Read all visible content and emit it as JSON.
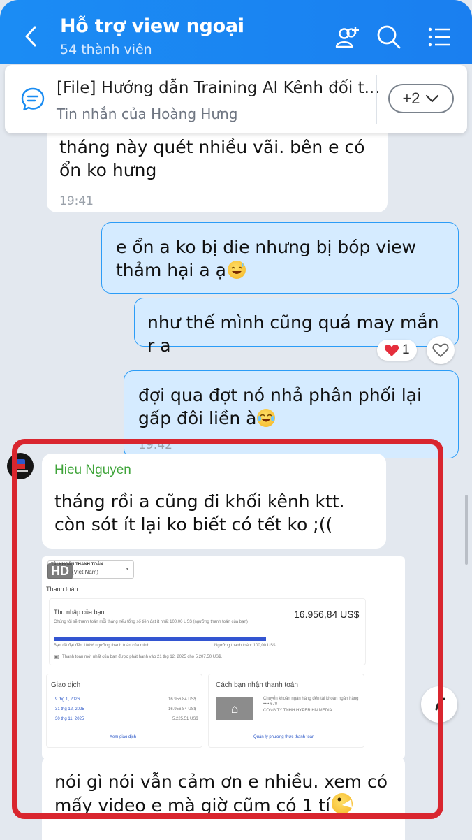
{
  "header": {
    "title": "Hỗ trợ view ngoại",
    "subtitle": "54 thành viên"
  },
  "pinned": {
    "title": "[File] Hướng dẫn Training AI Kênh đối t...",
    "subtitle": "Tin nhắn của Hoàng Hưng",
    "more_label": "+2"
  },
  "messages": [
    {
      "text": "tháng này quét nhiều vãi. bên e có ổn ko hưng",
      "time": "19:41"
    },
    {
      "text": "e ổn a ko bị die nhưng bị bóp view thảm hại a ạ"
    },
    {
      "text": "như thế mình cũng quá may mắn r a",
      "reaction_count": "1"
    },
    {
      "text": "đợi qua đợt nó nhả phân phối lại gấp đôi liền à",
      "time": "19:42"
    },
    {
      "sender": "Hieu Nguyen",
      "text": "tháng rồi a cũng đi khối kênh ktt. còn sót ít lại ko biết có tết ko ;(("
    },
    {
      "text": "nói gì nói vẫn cảm ơn e nhiều. xem có mấy video e mà giờ cũm có 1 tí"
    }
  ],
  "image": {
    "badge": "HD",
    "dropdown_title": "TÀI KHOẢN THANH TOÁN",
    "dropdown_value": "(Việt Nam)",
    "heading": "Thanh toán",
    "income_title": "Thu nhập của bạn",
    "income_amount": "16.956,84 US$",
    "income_note": "Chúng tôi sẽ thanh toán mỗi tháng nếu tổng số tiền đạt ít nhất 100,00 US$ (ngưỡng thanh toán của bạn)",
    "progress_left": "Bạn đã đạt đến 100% ngưỡng thanh toán của mình",
    "progress_right": "Ngưỡng thanh toán: 100,00 US$",
    "progress": 1.0,
    "last_payment": "Thanh toán mới nhất của bạn được phát hành vào 21 thg 12, 2025 cho 5.207,50 US$.",
    "transactions_title": "Giao dịch",
    "transactions": [
      {
        "date": "9 thg 1, 2026",
        "amount": "16.956,84 US$"
      },
      {
        "date": "31 thg 12, 2025",
        "amount": "16.956,84 US$"
      },
      {
        "date": "30 thg 11, 2025",
        "amount": "5.225,51 US$"
      }
    ],
    "transactions_link": "Xem giao dịch",
    "payout_title": "Cách bạn nhận thanh toán",
    "payout_line1": "Chuyển khoản ngân hàng đến tài khoản ngân hàng",
    "payout_line2": "•••• 670",
    "payout_line3": "CONG TY TNHH HYPER HN MEDIA",
    "payout_link": "Quản lý phương thức thanh toán"
  },
  "colors": {
    "accent": "#1b8cf4",
    "outgoing": "#d5ebff",
    "highlight": "#d9262f",
    "sender": "#3fa43a"
  }
}
